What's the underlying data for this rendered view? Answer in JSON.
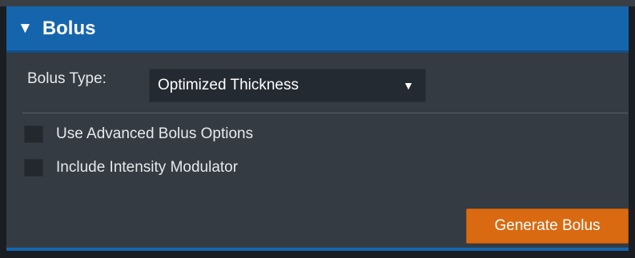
{
  "panel": {
    "title": "Bolus",
    "collapse_icon": "triangle-down-icon",
    "header_color": "#1565ad",
    "body_color": "#343b43"
  },
  "bolus_type": {
    "label": "Bolus Type:",
    "selected": "Optimized Thickness"
  },
  "options": {
    "advanced": {
      "label": "Use Advanced Bolus Options",
      "checked": false
    },
    "intensity_modulator": {
      "label": "Include Intensity Modulator",
      "checked": false
    }
  },
  "actions": {
    "generate_label": "Generate Bolus",
    "generate_color": "#d96a12"
  }
}
